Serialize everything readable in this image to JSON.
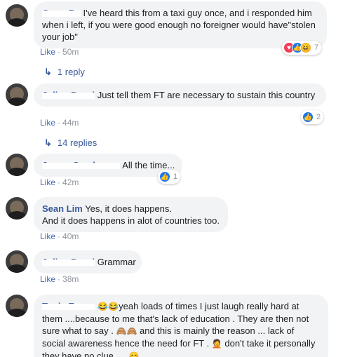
{
  "comments": [
    {
      "name": "Omar Bo",
      "text": "I've heard this from a taxi guy once, and i responded him when i left, if you were good enough no foreigner would have\"stolen your job\"",
      "like": "Like",
      "time": "50m",
      "reaction_count": "7",
      "reply_text": "1 reply"
    },
    {
      "name": "Julius Passi",
      "text": "Just tell them FT are necessary to sustain this country",
      "like": "Like",
      "time": "44m",
      "reaction_count": "2",
      "reply_text": "14 replies"
    },
    {
      "name": "James Sanderson",
      "text": "All the time...",
      "like": "Like",
      "time": "42m",
      "reaction_count": "1"
    },
    {
      "name": "Sean Lim",
      "text_line1": "Yes, it does happens.",
      "text_line2": "And it does happens in alot of countries too.",
      "like": "Like",
      "time": "40m"
    },
    {
      "name": "Julius Passi",
      "text": "Grammar",
      "like": "Like",
      "time": "38m"
    },
    {
      "name": "Tonia Evans",
      "emoji_lead": "😂😂",
      "text_a": "yeah loads of times I just laugh really hard at them ....because to me that's lack of education . They are then not sure what to say . ",
      "emoji_mid": "🙈🙈",
      "text_b": " and this is mainly the reason ... lack of social awareness hence the need for FT . ",
      "emoji_mid2": "🤦",
      "text_c": " don't take it personally they have no clue .... ",
      "emoji_end": "😊"
    }
  ],
  "separator": "·",
  "reaction_icons": {
    "like": "👍",
    "love": "♥",
    "haha": "😆"
  },
  "colors": {
    "link": "#385898",
    "meta": "#90949c",
    "bubble": "#f2f3f5",
    "like_blue": "#1877f2"
  }
}
